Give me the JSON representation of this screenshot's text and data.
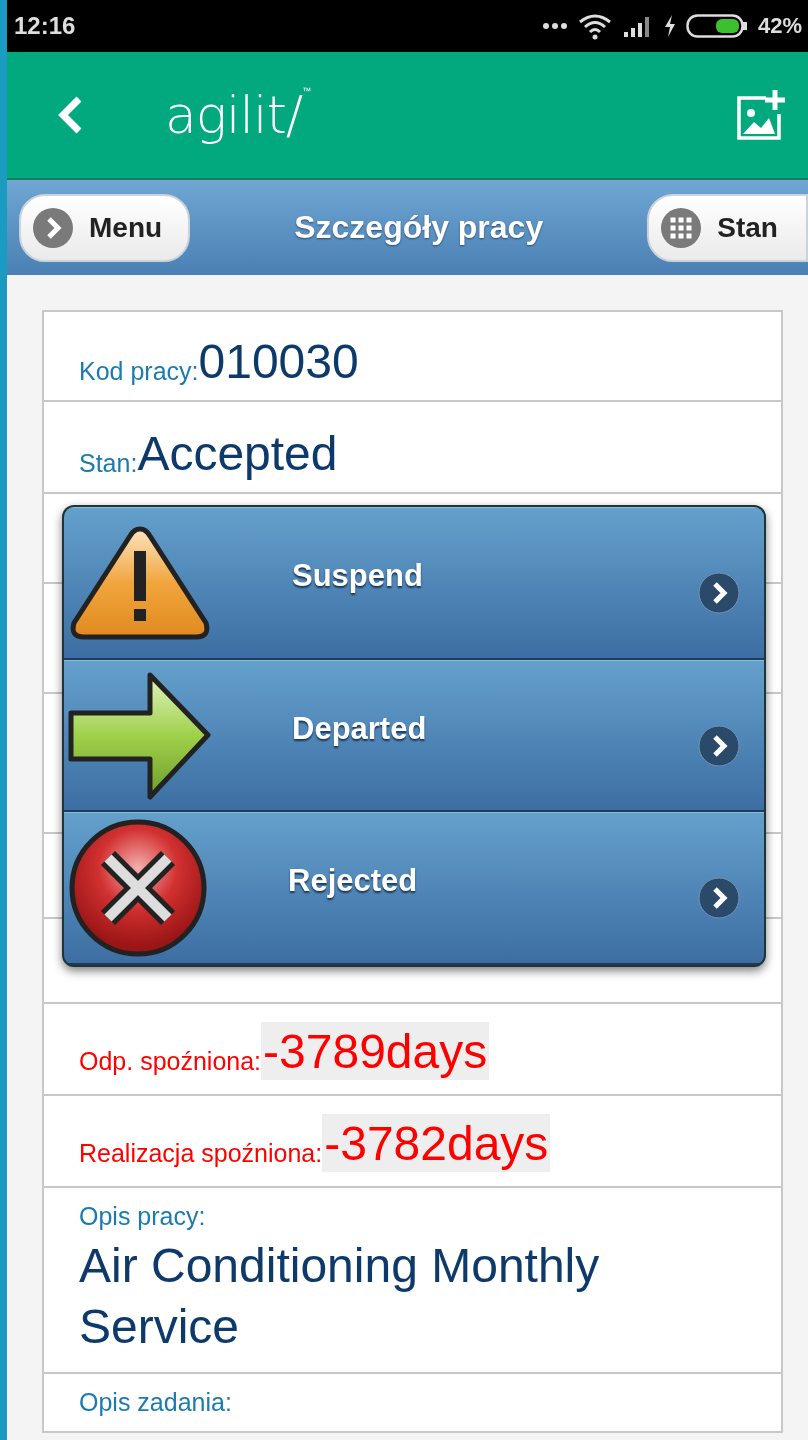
{
  "status_bar": {
    "time": "12:16",
    "battery": "42%"
  },
  "app_bar": {
    "logo": "agilit/",
    "trademark": "™"
  },
  "toolbar": {
    "left_button": "Menu",
    "title": "Szczegóły pracy",
    "right_button": "Stan"
  },
  "fields": [
    {
      "kind": "inline",
      "label": "Kod pracy:",
      "value": "010030"
    },
    {
      "kind": "inline",
      "label": "Stan:",
      "value": "Accepted"
    },
    {
      "kind": "covered"
    },
    {
      "kind": "covered"
    },
    {
      "kind": "covered"
    },
    {
      "kind": "covered"
    },
    {
      "kind": "covered"
    },
    {
      "kind": "overdue",
      "label": "Odp. spoźniona:",
      "value": "-3789days"
    },
    {
      "kind": "overdue",
      "label": "Realizacja spoźniona:",
      "value": "-3782days"
    },
    {
      "kind": "block",
      "label": "Opis pracy:",
      "value": "Air Conditioning Monthly Service"
    },
    {
      "kind": "block",
      "label": "Opis zadania:"
    }
  ],
  "status_menu": {
    "items": [
      {
        "kind": "warning",
        "label": "Suspend"
      },
      {
        "kind": "arrow",
        "label": "Departed"
      },
      {
        "kind": "cross",
        "label": "Rejected"
      }
    ]
  }
}
